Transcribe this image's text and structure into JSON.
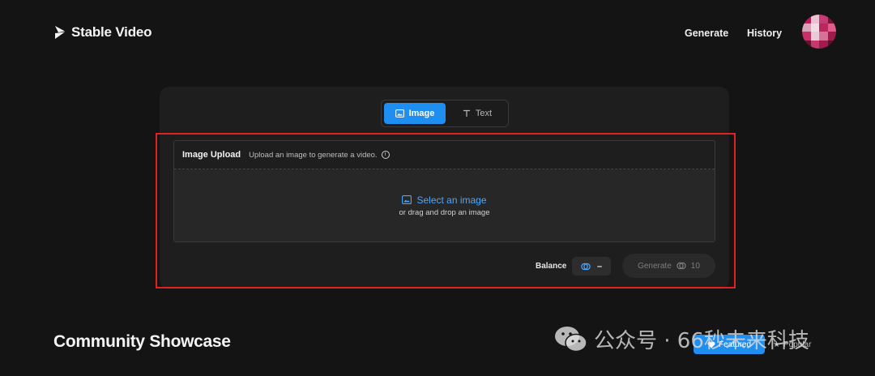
{
  "header": {
    "brand": "Stable Video",
    "nav": {
      "generate": "Generate",
      "history": "History"
    },
    "avatar_colors": [
      "#b51d5c",
      "#e8c2d2",
      "#c73a72",
      "#7a1238",
      "#d9a4bb",
      "#f2dbe5",
      "#b8285f",
      "#e35a8e",
      "#c93068",
      "#ecc9d7",
      "#d47298",
      "#9e1b4b",
      "#6b0f31",
      "#c4396f",
      "#a11a4e",
      "#5e0d2b"
    ]
  },
  "mode_switch": {
    "image": {
      "label": "Image",
      "icon": "image-icon"
    },
    "text": {
      "label": "Text",
      "icon": "text-icon"
    },
    "active": "image"
  },
  "upload": {
    "title": "Image Upload",
    "hint": "Upload an image to generate a video.",
    "select_label": "Select an image",
    "drag_label": "or drag and drop an image"
  },
  "footer_bar": {
    "balance_label": "Balance",
    "balance_value": "–",
    "generate_label": "Generate",
    "generate_cost": "10"
  },
  "showcase": {
    "title": "Community Showcase",
    "filters": {
      "featured": "Featured",
      "popular": "Popular"
    }
  },
  "watermark": {
    "text": "公众号 · 66秒未来科技"
  },
  "colors": {
    "background": "#141414",
    "card": "#1e1e1e",
    "accent": "#1f8ef1",
    "link": "#4aa8ff",
    "highlight": "#e02222"
  }
}
